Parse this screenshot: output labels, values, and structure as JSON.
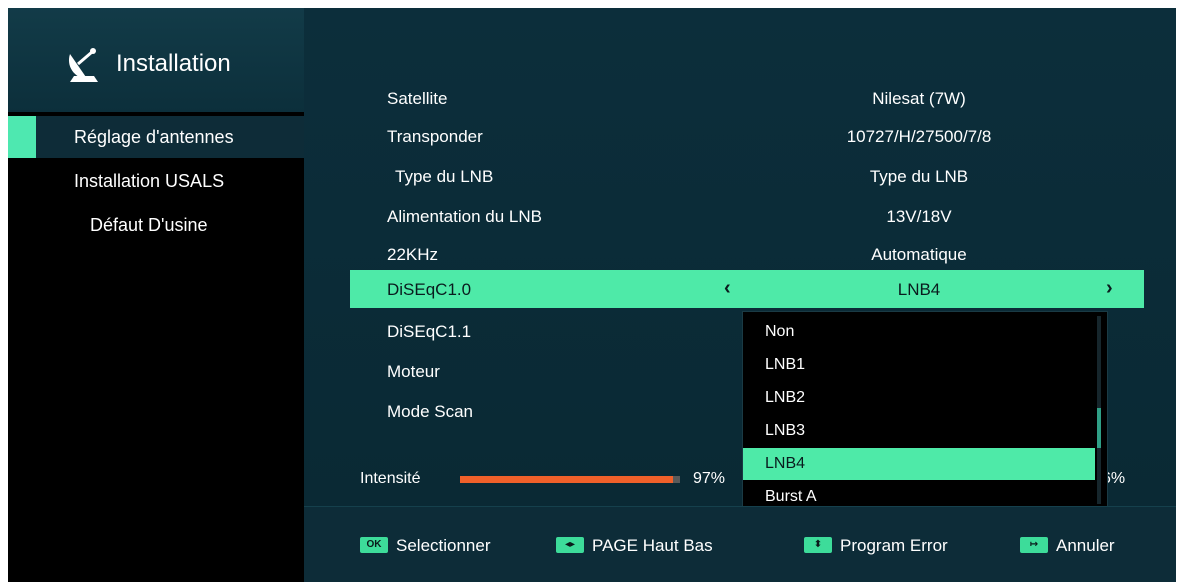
{
  "sidebar": {
    "title": "Installation",
    "items": [
      {
        "label": "Réglage d'antennes"
      },
      {
        "label": "Installation USALS"
      },
      {
        "label": "Défaut D'usine"
      }
    ]
  },
  "settings": [
    {
      "label": "Satellite",
      "value": "Nilesat (7W)"
    },
    {
      "label": "Transponder",
      "value": "10727/H/27500/7/8"
    },
    {
      "label": "Type du LNB",
      "value": "Type du LNB"
    },
    {
      "label": "Alimentation du LNB",
      "value": "13V/18V"
    },
    {
      "label": "22KHz",
      "value": "Automatique"
    },
    {
      "label": "DiSEqC1.0",
      "value": "LNB4"
    },
    {
      "label": "DiSEqC1.1",
      "value": ""
    },
    {
      "label": "Moteur",
      "value": ""
    },
    {
      "label": "Mode Scan",
      "value": ""
    }
  ],
  "signal": {
    "label": "Intensité",
    "strength_value": "97%",
    "strength_fraction": 0.97,
    "quality_value_partial": "6%"
  },
  "dropdown": {
    "options": [
      "Non",
      "LNB1",
      "LNB2",
      "LNB3",
      "LNB4",
      "Burst A"
    ],
    "selected": "LNB4"
  },
  "footer": {
    "hints": [
      {
        "key": "OK",
        "label": "Selectionner"
      },
      {
        "key": "◂▸",
        "label": "PAGE Haut Bas"
      },
      {
        "key": "⬍",
        "label": "Program Error"
      },
      {
        "key": "↦",
        "label": "Annuler"
      }
    ]
  },
  "colors": {
    "accent": "#4eeaa8",
    "panel": "#0c2e3b",
    "signal_bar": "#f0602a"
  },
  "icons": {
    "header": "satellite-dish-icon"
  }
}
